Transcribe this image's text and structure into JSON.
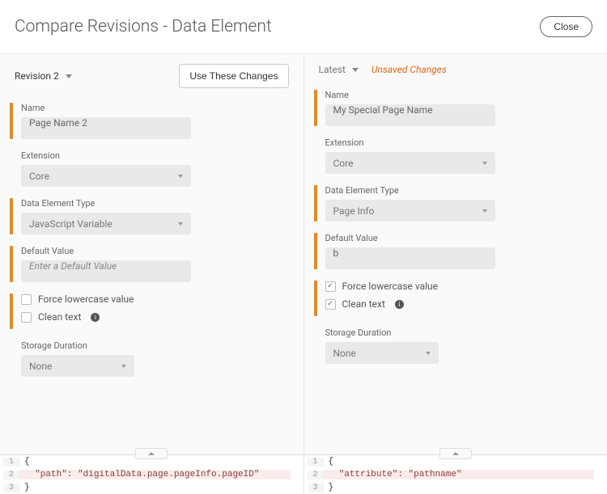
{
  "header": {
    "title": "Compare Revisions - Data Element",
    "close": "Close"
  },
  "left": {
    "revision_label": "Revision 2",
    "use_changes": "Use These Changes",
    "labels": {
      "name": "Name",
      "extension": "Extension",
      "type": "Data Element Type",
      "default": "Default Value",
      "storage": "Storage Duration"
    },
    "values": {
      "name": "Page Name 2",
      "extension": "Core",
      "type": "JavaScript Variable",
      "default_placeholder": "Enter a Default Value",
      "force_lower": "Force lowercase value",
      "clean_text": "Clean text",
      "storage": "None"
    },
    "code": {
      "l1": "{",
      "l2": "  \"path\": \"digitalData.page.pageInfo.pageID\"",
      "l3": "}"
    }
  },
  "right": {
    "revision_label": "Latest",
    "unsaved": "Unsaved Changes",
    "labels": {
      "name": "Name",
      "extension": "Extension",
      "type": "Data Element Type",
      "default": "Default Value",
      "storage": "Storage Duration"
    },
    "values": {
      "name": "My Special Page Name",
      "extension": "Core",
      "type": "Page Info",
      "default": "b",
      "force_lower": "Force lowercase value",
      "clean_text": "Clean text",
      "storage": "None"
    },
    "code": {
      "l1": "{",
      "l2": "  \"attribute\": \"pathname\"",
      "l3": "}"
    }
  }
}
